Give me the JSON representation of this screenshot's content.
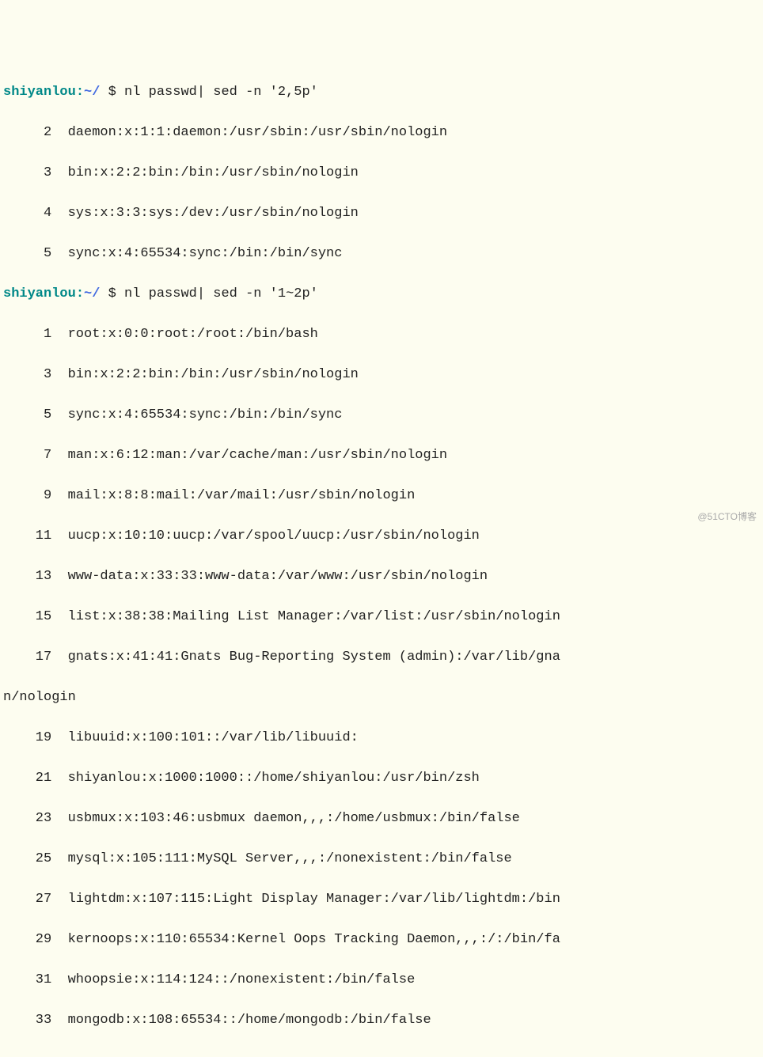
{
  "prompt1": {
    "user": "shiyanlou",
    "sep": ":",
    "tilde": "~/",
    "dollar": " $ ",
    "cmd": "nl passwd| sed -n '2,5p'"
  },
  "block1": {
    "lines": [
      {
        "n": "2",
        "t": "daemon:x:1:1:daemon:/usr/sbin:/usr/sbin/nologin"
      },
      {
        "n": "3",
        "t": "bin:x:2:2:bin:/bin:/usr/sbin/nologin"
      },
      {
        "n": "4",
        "t": "sys:x:3:3:sys:/dev:/usr/sbin/nologin"
      },
      {
        "n": "5",
        "t": "sync:x:4:65534:sync:/bin:/bin/sync"
      }
    ]
  },
  "prompt2": {
    "user": "shiyanlou",
    "sep": ":",
    "tilde": "~/",
    "dollar": " $ ",
    "cmd": "nl passwd| sed -n '1~2p'"
  },
  "block2": {
    "lines": [
      {
        "n": "1",
        "t": "root:x:0:0:root:/root:/bin/bash"
      },
      {
        "n": "3",
        "t": "bin:x:2:2:bin:/bin:/usr/sbin/nologin"
      },
      {
        "n": "5",
        "t": "sync:x:4:65534:sync:/bin:/bin/sync"
      },
      {
        "n": "7",
        "t": "man:x:6:12:man:/var/cache/man:/usr/sbin/nologin"
      },
      {
        "n": "9",
        "t": "mail:x:8:8:mail:/var/mail:/usr/sbin/nologin"
      },
      {
        "n": "11",
        "t": "uucp:x:10:10:uucp:/var/spool/uucp:/usr/sbin/nologin"
      },
      {
        "n": "13",
        "t": "www-data:x:33:33:www-data:/var/www:/usr/sbin/nologin"
      },
      {
        "n": "15",
        "t": "list:x:38:38:Mailing List Manager:/var/list:/usr/sbin/nologin"
      },
      {
        "n": "17",
        "t": "gnats:x:41:41:Gnats Bug-Reporting System (admin):/var/lib/gna"
      }
    ],
    "wrap": "n/nologin",
    "lines2": [
      {
        "n": "19",
        "t": "libuuid:x:100:101::/var/lib/libuuid:"
      },
      {
        "n": "21",
        "t": "shiyanlou:x:1000:1000::/home/shiyanlou:/usr/bin/zsh"
      },
      {
        "n": "23",
        "t": "usbmux:x:103:46:usbmux daemon,,,:/home/usbmux:/bin/false"
      },
      {
        "n": "25",
        "t": "mysql:x:105:111:MySQL Server,,,:/nonexistent:/bin/false"
      },
      {
        "n": "27",
        "t": "lightdm:x:107:115:Light Display Manager:/var/lib/lightdm:/bin"
      },
      {
        "n": "29",
        "t": "kernoops:x:110:65534:Kernel Oops Tracking Daemon,,,:/:/bin/fa"
      },
      {
        "n": "31",
        "t": "whoopsie:x:114:124::/nonexistent:/bin/false"
      },
      {
        "n": "33",
        "t": "mongodb:x:108:65534::/home/mongodb:/bin/false"
      }
    ]
  },
  "watermark": "@51CTO博客"
}
